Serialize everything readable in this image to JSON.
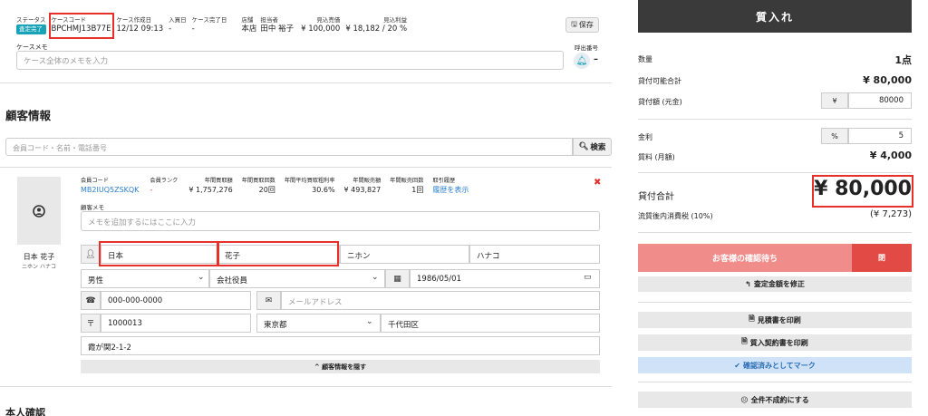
{
  "header": {
    "status_label": "ステータス",
    "status_badge": "査定完了",
    "case_code_label": "ケースコード",
    "case_code": "BPCHMJ13B77E",
    "created_label": "ケース作成日",
    "created": "12/12 09:13",
    "received_label": "入買日",
    "received": "-",
    "completed_label": "ケース完了日",
    "completed": "-",
    "store_label": "店舗",
    "store": "本店",
    "staff_label": "担当者",
    "staff": "田中 裕子",
    "expected_sales_label": "見込売価",
    "expected_sales": "¥ 100,000",
    "expected_profit_label": "見込利益",
    "expected_profit": "¥ 18,182 / 20 %",
    "save_label": "保存",
    "memo_label": "ケースメモ",
    "memo_placeholder": "ケース全体のメモを入力",
    "call_label": "呼出番号",
    "call_value": "–"
  },
  "customer": {
    "section_title": "顧客情報",
    "search_placeholder": "会員コード・名前・電話番号",
    "search_label": "検索",
    "name_display": "日本 花子",
    "kana_display": "ニホン ハナコ",
    "member_code_label": "会員コード",
    "member_code": "MB2IUQ5ZSKQK",
    "rank_label": "会員ランク",
    "rank": "-",
    "annual_amount_label": "年間買取額",
    "annual_amount": "¥ 1,757,276",
    "annual_count_label": "年間買取回数",
    "annual_count": "20回",
    "avg_margin_label": "年間平均買取粗利率",
    "avg_margin": "30.6%",
    "annual_sales_label": "年間販売額",
    "annual_sales": "¥ 493,827",
    "sales_count_label": "年間販売回数",
    "sales_count": "1回",
    "history_label": "取引履歴",
    "history_link": "履歴を表示",
    "cmemo_label": "顧客メモ",
    "cmemo_placeholder": "メモを追加するにはここに入力",
    "last_name": "日本",
    "first_name": "花子",
    "last_kana": "ニホン",
    "first_kana": "ハナコ",
    "gender": "男性",
    "occupation": "会社役員",
    "birthday": "1986/05/01",
    "phone": "000-000-0000",
    "email_placeholder": "メールアドレス",
    "postal": "1000013",
    "prefecture": "東京都",
    "city": "千代田区",
    "address": "霞が関2-1-2",
    "hide_label": "顧客情報を隠す"
  },
  "identity": {
    "section_title": "本人確認"
  },
  "pawn": {
    "title": "質入れ",
    "qty_label": "数量",
    "qty": "1点",
    "available_label": "貸付可能合計",
    "available": "¥ 80,000",
    "loan_label": "貸付額 (元金)",
    "loan_prefix": "¥",
    "loan_value": "80000",
    "interest_label": "金利",
    "interest_prefix": "%",
    "interest_value": "5",
    "fee_label": "質料 (月額)",
    "fee": "¥ 4,000",
    "total_label": "貸付合計",
    "total": "¥ 80,000",
    "tax_label": "流質後内消費税 (10%)",
    "tax": "(¥ 7,273)",
    "wait_label": "お客様の確認待ち",
    "side_btn": "閉",
    "fix_label": "査定金額を修正",
    "print_estimate": "見積書を印刷",
    "print_contract": "質入契約書を印刷",
    "mark_confirmed": "確認済みとしてマーク",
    "all_fail": "全件不成約にする"
  },
  "colors": {
    "accent_red": "#e8302a",
    "teal": "#17a2b8",
    "dark_header": "#3a3a3a",
    "wait_btn": "#f08c8a",
    "side_btn": "#e24b45",
    "confirm_btn": "#cfe2f7"
  }
}
